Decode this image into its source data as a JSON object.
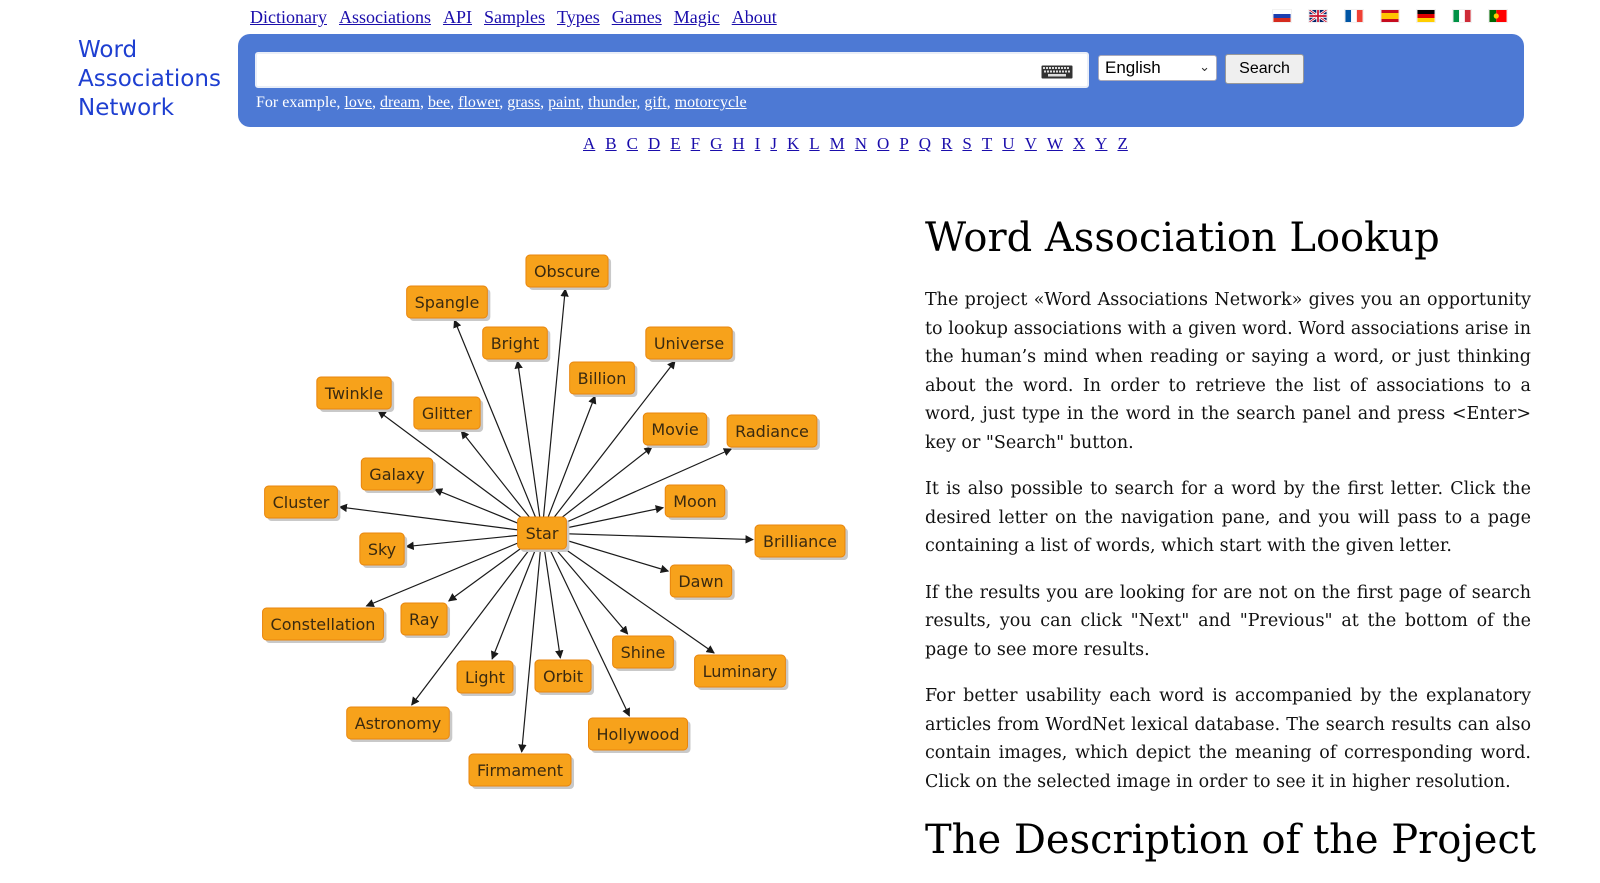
{
  "nav": {
    "links": [
      "Dictionary",
      "Associations",
      "API",
      "Samples",
      "Types",
      "Games",
      "Magic",
      "About"
    ]
  },
  "flags": [
    "russia-flag",
    "uk-flag",
    "france-flag",
    "spain-flag",
    "germany-flag",
    "italy-flag",
    "portugal-flag"
  ],
  "logo": {
    "line1": "Word",
    "line2": "Associations",
    "line3": "Network"
  },
  "search": {
    "value": "",
    "language": "English",
    "button": "Search",
    "examples_prefix": "For example, ",
    "examples": [
      "love",
      "dream",
      "bee",
      "flower",
      "grass",
      "paint",
      "thunder",
      "gift",
      "motorcycle"
    ]
  },
  "alphabet": [
    "A",
    "B",
    "C",
    "D",
    "E",
    "F",
    "G",
    "H",
    "I",
    "J",
    "K",
    "L",
    "M",
    "N",
    "O",
    "P",
    "Q",
    "R",
    "S",
    "T",
    "U",
    "V",
    "W",
    "X",
    "Y",
    "Z"
  ],
  "graph": {
    "center": "Star",
    "nodes": [
      "Obscure",
      "Spangle",
      "Bright",
      "Universe",
      "Billion",
      "Twinkle",
      "Glitter",
      "Movie",
      "Radiance",
      "Galaxy",
      "Cluster",
      "Moon",
      "Brilliance",
      "Sky",
      "Dawn",
      "Constellation",
      "Ray",
      "Shine",
      "Luminary",
      "Light",
      "Orbit",
      "Astronomy",
      "Hollywood",
      "Firmament"
    ]
  },
  "article": {
    "title": "Word Association Lookup",
    "paragraphs": [
      "The project «Word Associations Network» gives you an opportunity to lookup associations with a given word. Word associations arise in the human’s mind when reading or saying a word, or just thinking about the word. In order to retrieve the list of associations to a word, just type in the word in the search panel and press <Enter> key or \"Search\" button.",
      "It is also possible to search for a word by the first letter. Click the desired letter on the navigation pane, and you will pass to a page containing a list of words, which start with the given letter.",
      "If the results you are looking for are not on the first page of search results, you can click \"Next\" and \"Previous\" at the bottom of the page to see more results.",
      "For better usability each word is accompanied by the explanatory articles from WordNet lexical database. The search results can also contain images, which depict the meaning of corresponding word. Click on the selected image in order to see it in higher resolution."
    ],
    "heading2": "The Description of the Project"
  }
}
